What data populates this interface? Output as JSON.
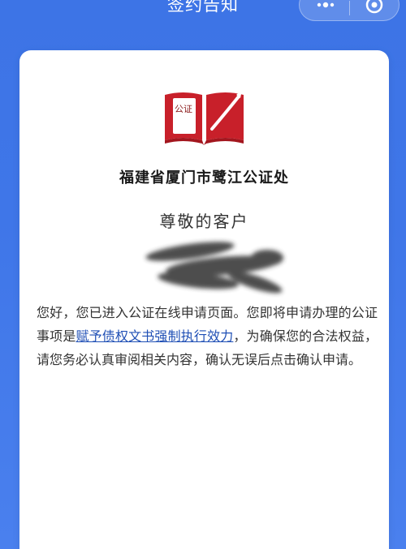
{
  "header": {
    "title": "签约告知",
    "more_icon": "more-dots-icon",
    "close_icon": "target-circle-icon"
  },
  "card": {
    "logo_icon": "notary-book-pen-logo",
    "logo_text": "公证",
    "org_name": "福建省厦门市鹭江公证处",
    "greeting": "尊敬的客户",
    "body": {
      "part1": "您好，您已进入公证在线申请页面。您即将申请办理的公证事项是",
      "item_link": "赋予债权文书强制执行效力",
      "part2": "，为确保您的合法权益，请您务必认真审阅相关内容，确认无误后点击确认申请。"
    }
  },
  "colors": {
    "background": "#3d74e6",
    "card": "#ffffff",
    "logo_red": "#c8202a",
    "link": "#1f4fb5"
  }
}
